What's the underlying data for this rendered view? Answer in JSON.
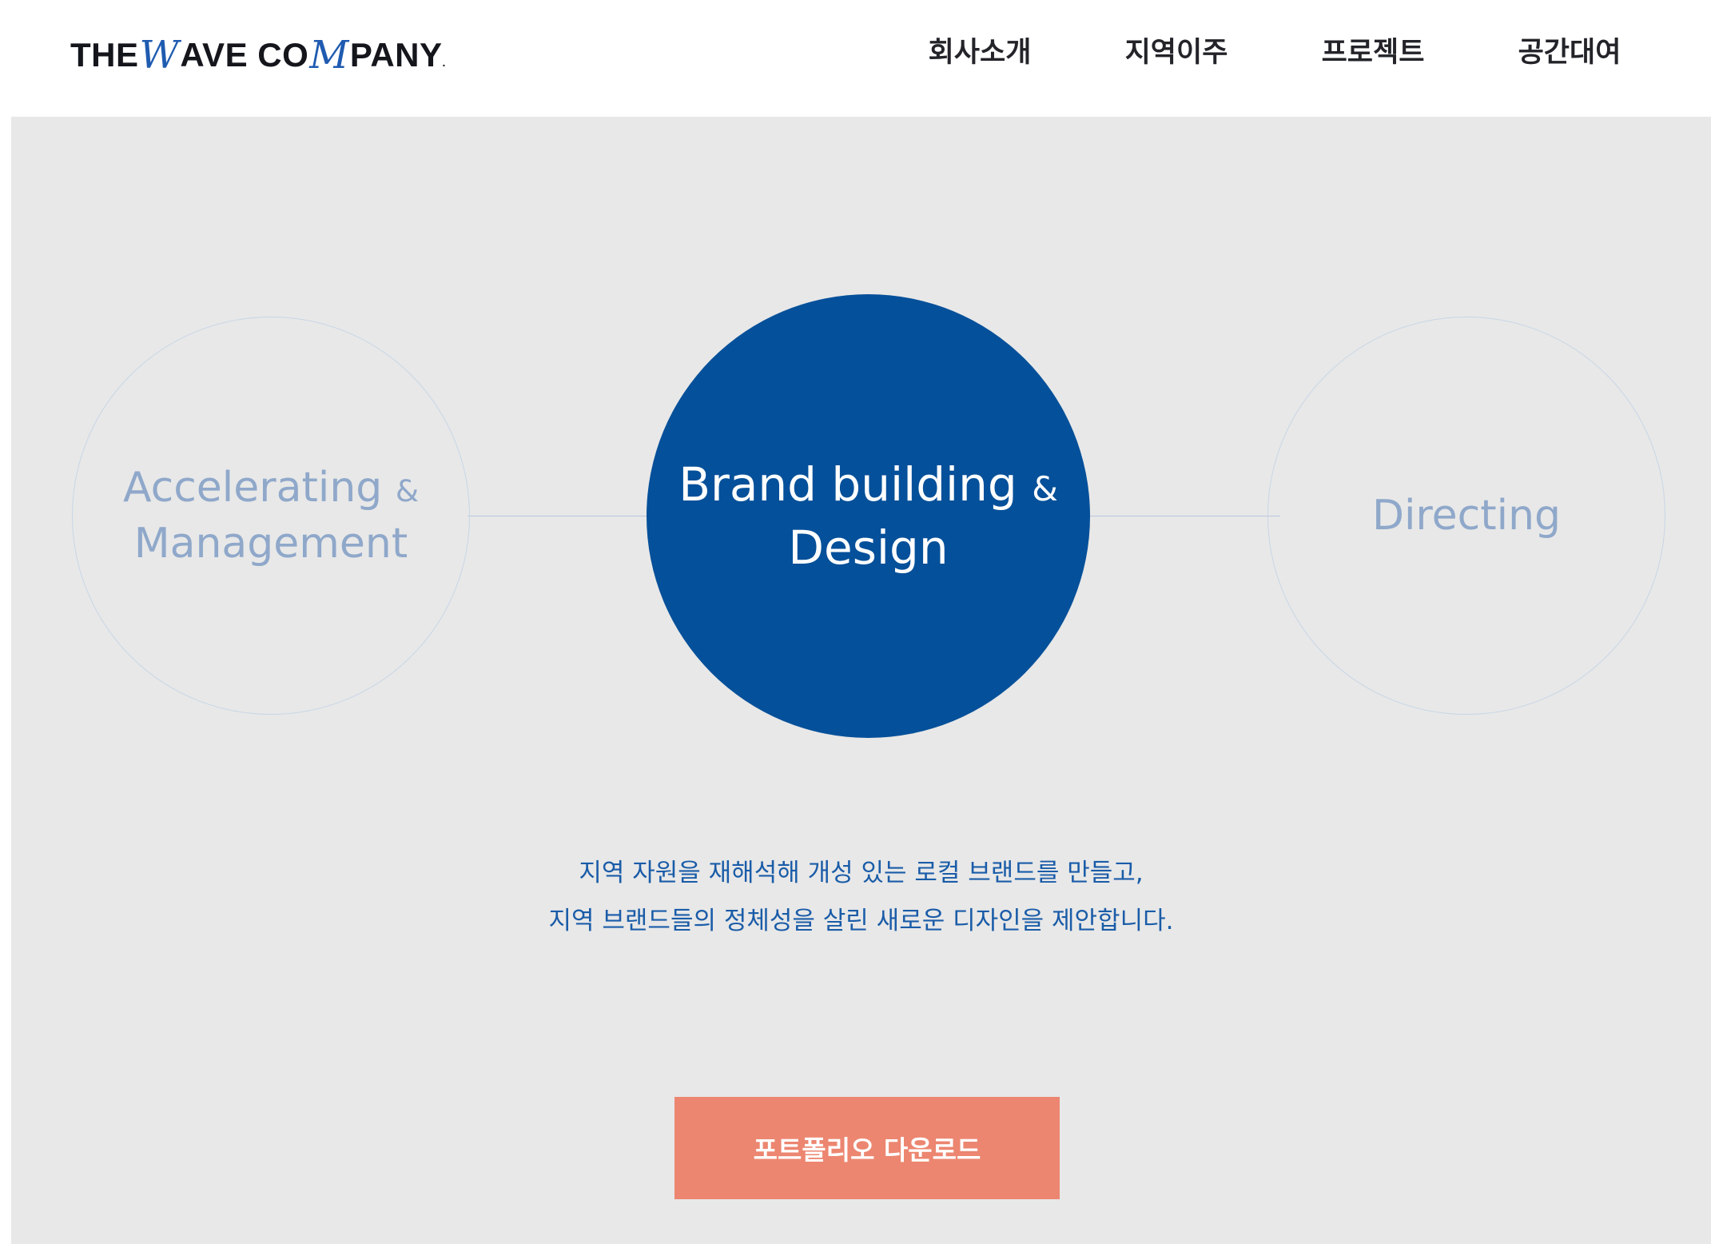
{
  "header": {
    "logo": {
      "part1": "THE ",
      "script1": "W",
      "part2": "AVE CO",
      "script2": "M",
      "part3": "PANY",
      "tm": "."
    },
    "nav": [
      {
        "label": "회사소개"
      },
      {
        "label": "지역이주"
      },
      {
        "label": "프로젝트"
      },
      {
        "label": "공간대여"
      }
    ]
  },
  "services": {
    "left": {
      "line1": "Accelerating",
      "amp": "&",
      "line2": "Management"
    },
    "center": {
      "line1": "Brand building",
      "amp": "&",
      "line2": "Design"
    },
    "right": {
      "line1": "Directing"
    }
  },
  "description": {
    "line1": "지역 자원을 재해석해 개성 있는 로컬 브랜드를 만들고,",
    "line2": "지역 브랜드들의 정체성을 살린 새로운 디자인을 제안합니다."
  },
  "cta": {
    "label": "포트폴리오 다운로드"
  },
  "colors": {
    "accent_blue": "#05509a",
    "cta_coral": "#ec8670",
    "background": "#e8e8e8"
  }
}
